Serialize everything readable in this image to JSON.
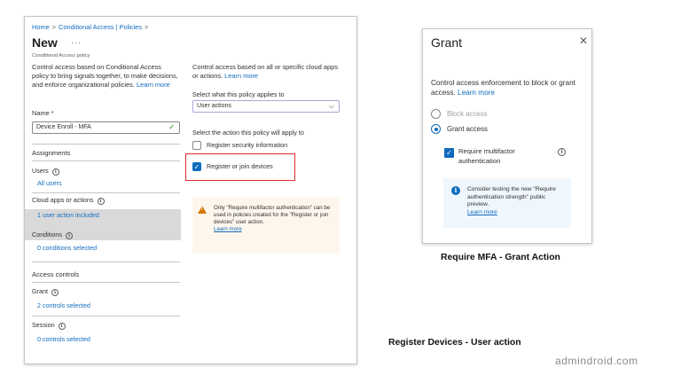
{
  "left_panel": {
    "breadcrumb": [
      "Home",
      "Conditional Access | Policies"
    ],
    "title": "New",
    "more": "···",
    "subtitle": "Conditional Access policy",
    "description_left": "Control access based on Conditional Access policy to bring signals together, to make decisions, and enforce organizational policies.",
    "learn_more": "Learn more",
    "name_label": "Name *",
    "name_value": "Device Enroll - MFA",
    "assignments_heading": "Assignments",
    "users_label": "Users",
    "users_value": "All users",
    "cloud_apps_label": "Cloud apps or actions",
    "cloud_apps_value": "1 user action included",
    "conditions_label": "Conditions",
    "conditions_value": "0 conditions selected",
    "access_controls_heading": "Access controls",
    "grant_label": "Grant",
    "grant_value": "2 controls selected",
    "session_label": "Session",
    "session_value": "0 controls selected",
    "description_right": "Control access based on all or specific cloud apps or actions.",
    "applies_label": "Select what this policy applies to",
    "applies_value": "User actions",
    "action_label": "Select the action this policy will apply to",
    "actions": [
      {
        "label": "Register security information",
        "checked": false
      },
      {
        "label": "Register or join devices",
        "checked": true
      }
    ],
    "warning_text": "Only \"Require multifactor authentication\" can be used in policies created for the \"Register or join devices\" user action.",
    "warning_link": "Learn more"
  },
  "grant_panel": {
    "title": "Grant",
    "description": "Control access enforcement to block or grant access.",
    "learn_more": "Learn more",
    "options": [
      {
        "label": "Block access",
        "selected": false
      },
      {
        "label": "Grant access",
        "selected": true
      }
    ],
    "mfa_label": "Require multifactor authentication",
    "mfa_checked": true,
    "info_text": "Consider testing the new \"Require authentication strength\" public preview.",
    "info_link": "Learn more"
  },
  "captions": {
    "grant_caption": "Require MFA - Grant Action",
    "user_action_caption": "Register Devices - User action"
  },
  "watermark": "admindroid.com",
  "colors": {
    "accent": "#0f6cbd",
    "highlight_box": "#e02a2a",
    "warning_icon": "#d47500"
  }
}
